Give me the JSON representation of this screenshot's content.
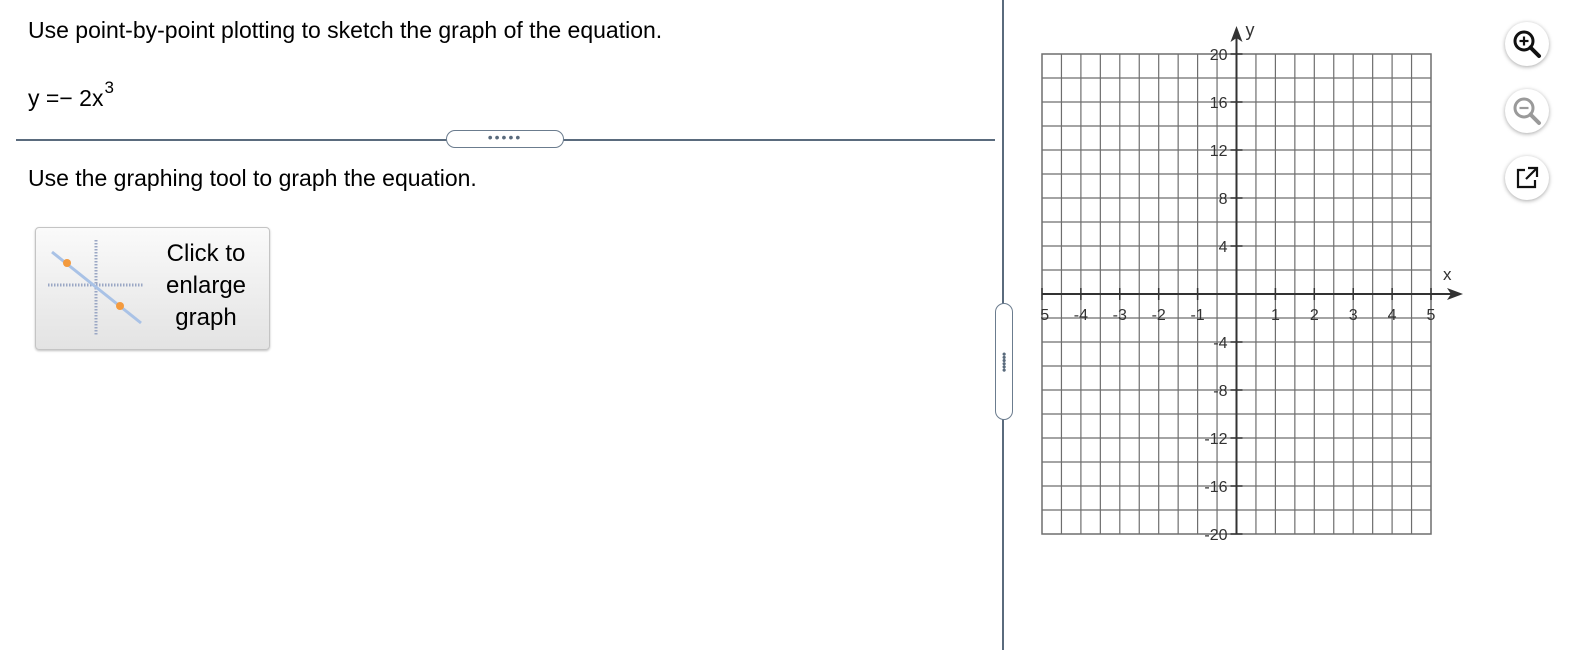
{
  "question": {
    "instruction": "Use point-by-point plotting to sketch the graph of the equation.",
    "equation": {
      "lhs": "y = ",
      "coefficient": "− 2x",
      "exponent": "3"
    },
    "tool_instruction": "Use the graphing tool to graph the equation.",
    "divider_handle": "•••••"
  },
  "enlarge_button": {
    "line1": "Click to",
    "line2": "enlarge",
    "line3": "graph"
  },
  "pane_handle": "••••••",
  "graph": {
    "x_axis_label": "x",
    "y_axis_label": "y",
    "x_range": [
      -5,
      5
    ],
    "y_range": [
      -20,
      20
    ],
    "x_minor_step": 0.5,
    "y_minor_step": 2,
    "x_tick_labels": [
      "-5",
      "-4",
      "-3",
      "-2",
      "-1",
      "1",
      "2",
      "3",
      "4",
      "5"
    ],
    "y_tick_labels": [
      "20",
      "16",
      "12",
      "8",
      "4",
      "-4",
      "-8",
      "-12",
      "-16",
      "-20"
    ],
    "grid": true,
    "colors": {
      "grid": "#6e6e6e",
      "axis": "#333333"
    }
  },
  "toolbar": {
    "zoom_in": "zoom-in-icon",
    "zoom_out": "zoom-out-icon",
    "open_new_window": "external-link-icon"
  }
}
